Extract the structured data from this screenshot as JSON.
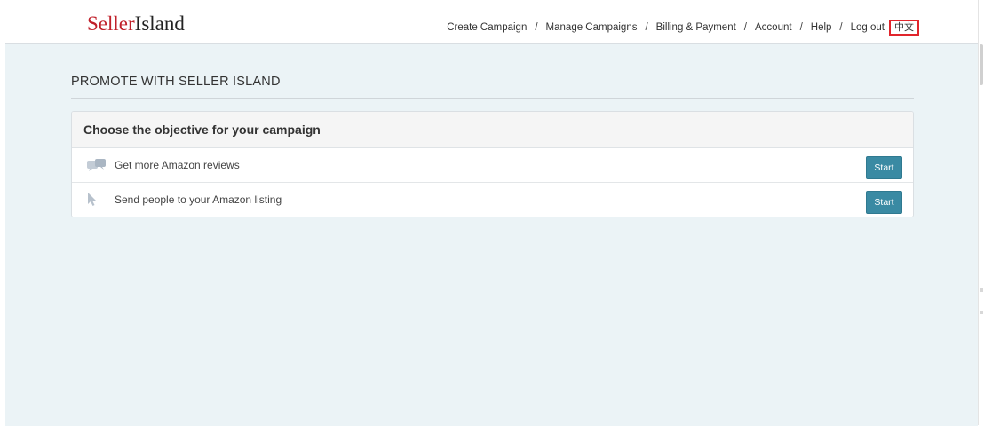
{
  "brand": {
    "part1": "Seller",
    "part2": "Island"
  },
  "nav": {
    "links": [
      "Create Campaign",
      "Manage Campaigns",
      "Billing & Payment",
      "Account",
      "Help",
      "Log out"
    ],
    "separator": "/",
    "lang": "中文"
  },
  "page": {
    "heading": "PROMOTE WITH SELLER ISLAND"
  },
  "panel": {
    "title": "Choose the objective for your campaign",
    "options": [
      {
        "label": "Get more Amazon reviews",
        "icon": "chat-bubbles-icon",
        "button": "Start"
      },
      {
        "label": "Send people to your Amazon listing",
        "icon": "cursor-arrow-icon",
        "button": "Start"
      }
    ]
  },
  "colors": {
    "brand_red": "#c0202a",
    "button": "#3a8aa3",
    "background": "#ebf3f6",
    "highlight_border": "#e1252c"
  }
}
